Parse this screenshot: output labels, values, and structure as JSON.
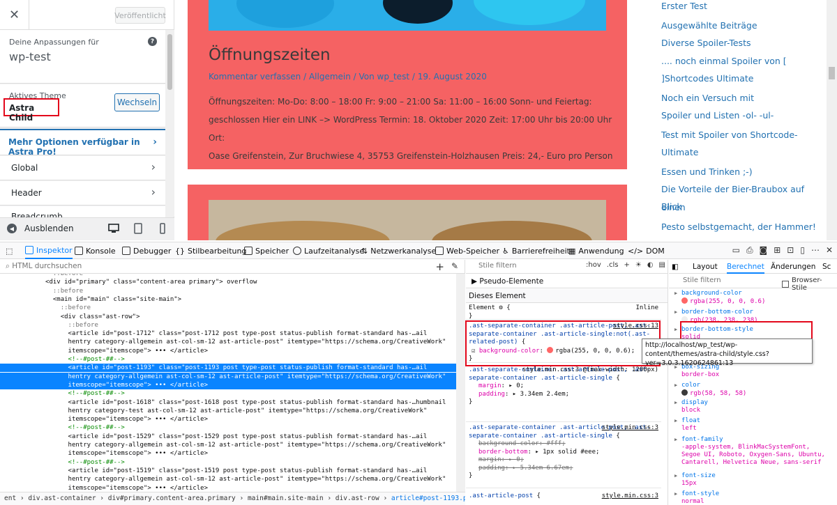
{
  "customizer": {
    "close_icon": "close-icon",
    "publish_label": "Veröffentlicht",
    "info_label": "Deine Anpassungen für",
    "site_name": "wp-test",
    "help_icon": "?",
    "theme_label": "Aktives Theme",
    "theme_name": "Astra Child",
    "switch_label": "Wechseln",
    "pro_label": "Mehr Optionen verfügbar in Astra Pro!",
    "sections": [
      "Global",
      "Header",
      "Breadcrumb"
    ],
    "hide_label": "Ausblenden"
  },
  "article": {
    "title": "Öffnungszeiten",
    "meta": "Kommentar verfassen / Allgemein / Von wp_test / 19. August 2020",
    "body_lines": [
      "Öffnungszeiten: Mo-Do: 8:00 – 18:00 Fr:            9:00 – 21:00 Sa:          11:00 – 16:00 Sonn- und Feiertag:",
      "geschlossen Hier ein LINK –> WordPress Termin: 18. Oktober 2020 Zeit: 17:00 Uhr bis 20:00 Uhr Ort:",
      "Oase Greifenstein, Zur Bruchwiese 4, 35753 Greifenstein-Holzhausen Preis: 24,- Euro pro Person"
    ]
  },
  "sidebar_links": [
    "Erster Test",
    "Ausgewählte Beiträge",
    "Diverse Spoiler-Tests",
    ".... noch einmal Spoiler von [",
    "]Shortcodes Ultimate",
    "Noch ein Versuch mit",
    "Spoiler und Listen -ol- -ul-",
    "Test mit Spoiler von Shortcode-",
    "Ultimate",
    "Essen und Trinken ;-)",
    "Die Vorteile der Bier-Braubox auf einen",
    "Blick",
    "Pesto selbstgemacht, der Hammer!"
  ],
  "devtools": {
    "tabs": [
      "Inspektor",
      "Konsole",
      "Debugger",
      "Stilbearbeitung",
      "Speicher",
      "Laufzeitanalyse",
      "Netzwerkanalyse",
      "Web-Speicher",
      "Barrierefreiheit",
      "Anwendung",
      "DOM"
    ],
    "html_search_placeholder": "HTML durchsuchen",
    "tree": [
      "              ::before",
      "            <div id=\"primary\" class=\"content-area primary\"> overflow",
      "              ::before",
      "              <main id=\"main\" class=\"site-main\">",
      "                ::before",
      "                <div class=\"ast-row\">",
      "                  ::before",
      "                  <article id=\"post-1712\" class=\"post-1712 post type-post status-publish format-standard has-…ail",
      "                  hentry category-allgemein ast-col-sm-12 ast-article-post\" itemtype=\"https://schema.org/CreativeWork\"",
      "                  itemscope=\"itemscope\"> ••• </article>",
      "                  <!--#post-##-->",
      "                  <article id=\"post-1193\" class=\"post-1193 post type-post status-publish format-standard has-…ail",
      "                  hentry category-allgemein ast-col-sm-12 ast-article-post\" itemtype=\"https://schema.org/CreativeWork\"",
      "                  itemscope=\"itemscope\"> ••• </article>",
      "                  <!--#post-##-->",
      "                  <article id=\"post-1618\" class=\"post-1618 post type-post status-publish format-standard has-…humbnail",
      "                  hentry category-test ast-col-sm-12 ast-article-post\" itemtype=\"https://schema.org/CreativeWork\"",
      "                  itemscope=\"itemscope\"> ••• </article>",
      "                  <!--#post-##-->",
      "                  <article id=\"post-1529\" class=\"post-1529 post type-post status-publish format-standard has-…ail",
      "                  hentry category-allgemein ast-col-sm-12 ast-article-post\" itemtype=\"https://schema.org/CreativeWork\"",
      "                  itemscope=\"itemscope\"> ••• </article>",
      "                  <!--#post-##-->",
      "                  <article id=\"post-1519\" class=\"post-1519 post type-post status-publish format-standard has-…ail",
      "                  hentry category-allgemein ast-col-sm-12 ast-article-post\" itemtype=\"https://schema.org/CreativeWork\"",
      "                  itemscope=\"itemscope\"> ••• </article>"
    ],
    "breadcrumbs": [
      "ent",
      "div.ast-container",
      "div#primary.content-area.primary",
      "main#main.site-main",
      "div.ast-row",
      "article#post-1193.post.type-po…"
    ],
    "rules_filter": "Stile filtern",
    "rules_opts": [
      ":hov",
      ".cls"
    ],
    "pseudo_label": "Pseudo-Elemente",
    "this_element": "Dieses Element",
    "element_rule": "Element",
    "inline": "Inline",
    "rule1": {
      "selector": ".ast-separate-container .ast-article-post, .ast-separate-container .ast-article-single:not(.ast-related-post)",
      "source": "style.css:13",
      "prop": "background-color",
      "value": "rgba(255, 0, 0, 0.6)"
    },
    "rule2": {
      "selector": ".ast-separate-container .ast-article-post, .ast-separate-container .ast-article-single",
      "source": "style.min.css:3 @(max-width: 1200px)",
      "props": [
        [
          "margin",
          "0"
        ],
        [
          "padding",
          "3.34em 2.4em"
        ]
      ]
    },
    "rule3": {
      "selector": ".ast-separate-container .ast-article-post, .ast-separate-container .ast-article-single",
      "source": "style.min.css:3",
      "props": [
        [
          "background-color",
          "#fff"
        ],
        [
          "border-bottom",
          "1px solid #eee"
        ],
        [
          "margin",
          "0"
        ],
        [
          "padding",
          "5.34em 6.67em"
        ]
      ]
    },
    "rule4": {
      "selector": ".ast-article-post",
      "source": "style.min.css:3"
    },
    "computed_tabs": [
      "Layout",
      "Berechnet",
      "Änderungen",
      "Sc"
    ],
    "computed_filter": "Stile filtern",
    "browser_styles": "Browser-Stile",
    "computed": [
      [
        "background-color",
        "rgba(255, 0, 0, 0.6)"
      ],
      [
        "border-bottom-color",
        "rgb(238, 238, 238)"
      ],
      [
        "border-bottom-style",
        "solid"
      ],
      [
        "box-sizing",
        "border-box"
      ],
      [
        "color",
        "rgb(58, 58, 58)"
      ],
      [
        "display",
        "block"
      ],
      [
        "float",
        "left"
      ],
      [
        "font-family",
        "-apple-system, BlinkMacSystemFont, Segoe UI, Roboto, Oxygen-Sans, Ubuntu, Cantarell, Helvetica Neue, sans-serif"
      ],
      [
        "font-size",
        "15px"
      ],
      [
        "font-style",
        "normal"
      ]
    ],
    "tooltip": "http://localhost/wp_test/wp-content/themes/astra-child/style.css?ver=3.0.3.1620624861:13"
  },
  "colors": {
    "article_bg": "#f56263",
    "accent": "#0a84ff",
    "wp_blue": "#2271b1",
    "highlight_red": "#e3071b"
  }
}
